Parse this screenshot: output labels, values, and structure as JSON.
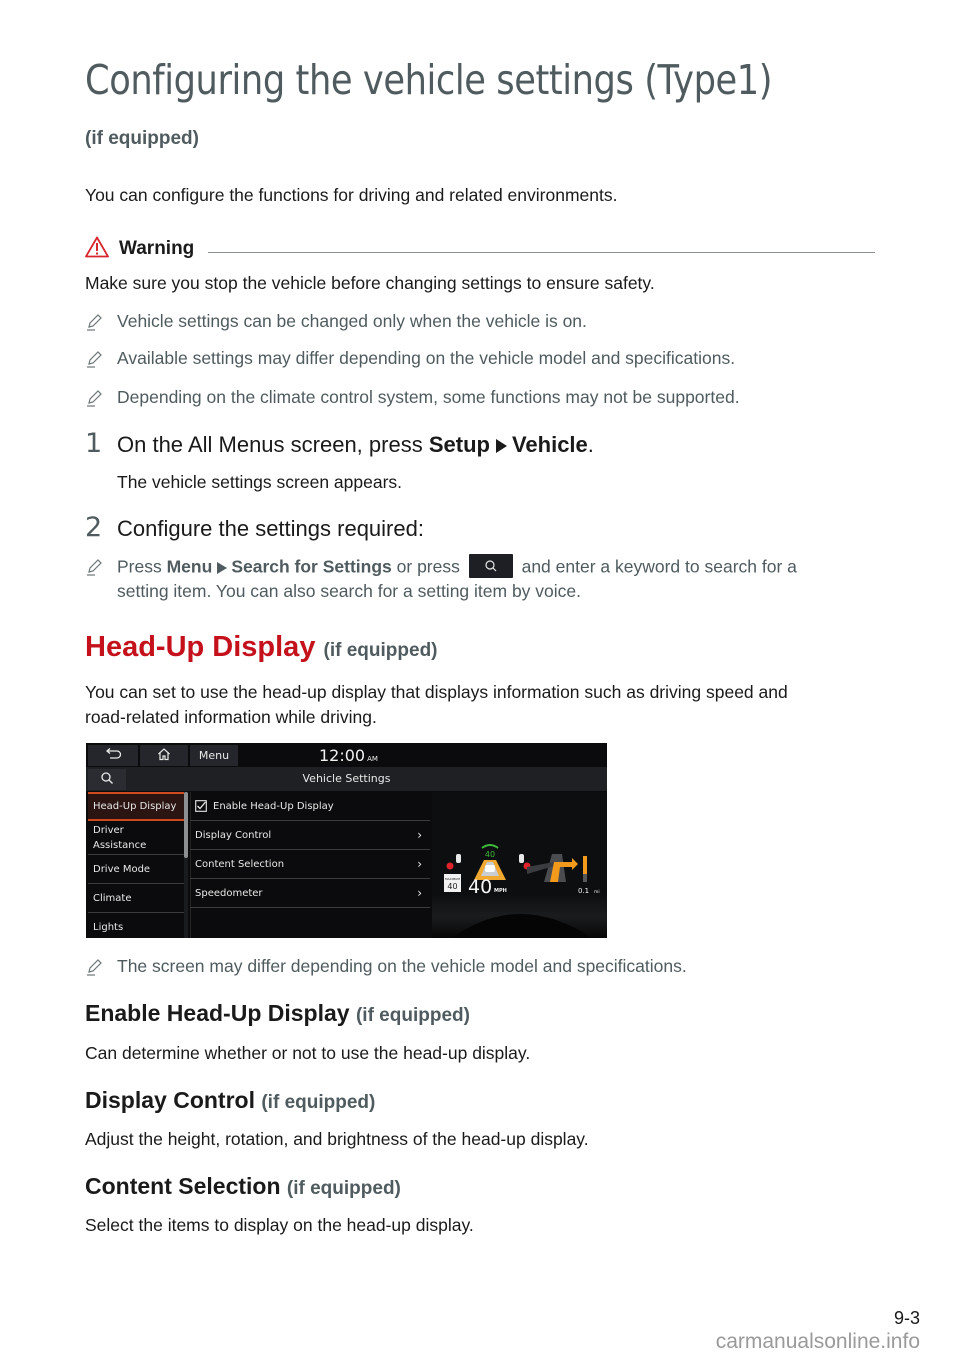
{
  "page": {
    "title": "Configuring the vehicle settings (Type1)",
    "subtitle": "(if equipped)",
    "intro": "You can configure the functions for driving and related environments.",
    "warning": {
      "icon": "warning-triangle-icon",
      "label": "Warning",
      "text": "Make sure you stop the vehicle before changing settings to ensure safety."
    },
    "notes": [
      "Vehicle settings can be changed only when the vehicle is on.",
      "Available settings may differ depending on the vehicle model and specifications.",
      "Depending on the climate control system, some functions may not be supported."
    ],
    "steps": [
      {
        "number": "1",
        "text_prefix": "On the All Menus screen, press ",
        "bold1": "Setup",
        "bold2": "Vehicle",
        "text_suffix": ".",
        "result": "The vehicle settings screen appears."
      },
      {
        "number": "2",
        "text": "Configure the settings required:",
        "note_prefix": "Press ",
        "note_bold1": "Menu",
        "note_bold2": "Search for Settings",
        "note_mid": " or press ",
        "note_suffix": " and enter a keyword to search for a",
        "note_line2": "setting item. You can also search for a setting item by voice."
      }
    ],
    "hud_section": {
      "heading": "Head-Up Display",
      "qualifier": "(if equipped)",
      "desc_line1": "You can set to use the head-up display that displays information such as driving speed and",
      "desc_line2": "road-related information while driving.",
      "screen_note": "The screen may differ depending on the vehicle model and specifications."
    },
    "subsections": [
      {
        "heading": "Enable Head-Up Display",
        "qualifier": "(if equipped)",
        "desc": "Can determine whether or not to use the head-up display."
      },
      {
        "heading": "Display Control",
        "qualifier": "(if equipped)",
        "desc": "Adjust the height, rotation, and brightness of the head-up display."
      },
      {
        "heading": "Content Selection",
        "qualifier": "(if equipped)",
        "desc": "Select the items to display on the head-up display."
      }
    ],
    "page_number": "9-3",
    "watermark": "carmanualsonline.info"
  },
  "screen": {
    "topbar": {
      "back_icon": "back-icon",
      "home_icon": "home-icon",
      "menu_label": "Menu",
      "time": "12:00",
      "ampm": "AM"
    },
    "header": {
      "search_icon": "search-icon",
      "title": "Vehicle Settings"
    },
    "sidebar": [
      {
        "label": "Head-Up Display",
        "active": true
      },
      {
        "label": "Driver\nAssistance",
        "active": false
      },
      {
        "label": "Drive Mode",
        "active": false
      },
      {
        "label": "Climate",
        "active": false
      },
      {
        "label": "Lights",
        "active": false
      }
    ],
    "list": [
      {
        "label": "Enable Head-Up Display",
        "checkbox": true,
        "checked": true
      },
      {
        "label": "Display Control",
        "chevron": true
      },
      {
        "label": "Content Selection",
        "chevron": true
      },
      {
        "label": "Speedometer",
        "chevron": true
      }
    ],
    "hud_preview": {
      "speed": "40",
      "speed_unit": "MPH",
      "speed_limit_label": "MAXIMUM",
      "speed_limit": "40",
      "cruise_speed": "40",
      "nav_distance": "0.1",
      "nav_unit": "mi"
    }
  },
  "colors": {
    "accent_red": "#c4111b",
    "title_gray": "#4f5b5e",
    "active_orange": "#d04a1f",
    "hud_orange": "#f39a1c",
    "hud_green": "#3dbb3a",
    "hud_red": "#e0222a"
  }
}
